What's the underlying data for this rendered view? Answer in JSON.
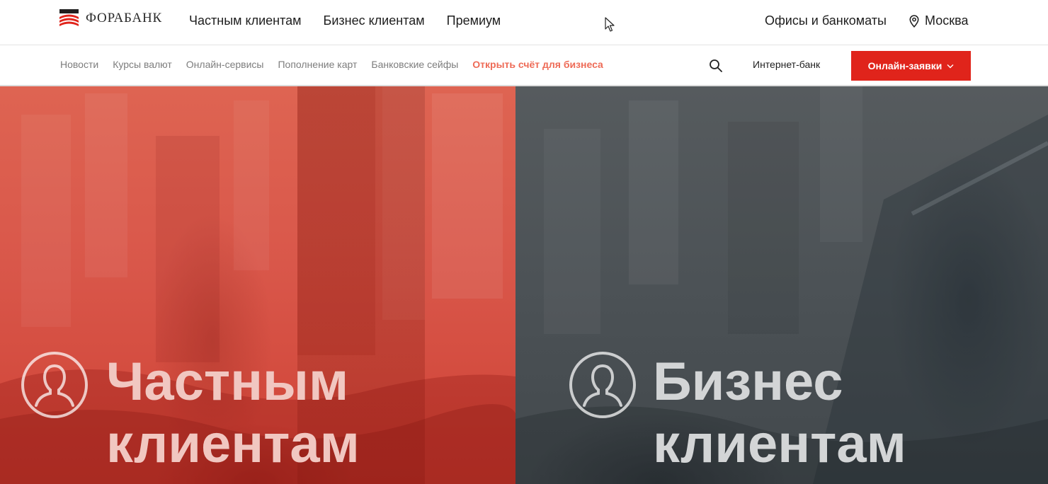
{
  "header": {
    "logo_text": "ФОРАБАНК",
    "main_nav": [
      {
        "label": "Частным клиентам"
      },
      {
        "label": "Бизнес клиентам"
      },
      {
        "label": "Премиум"
      }
    ],
    "offices_label": "Офисы и банкоматы",
    "city_label": "Москва"
  },
  "subheader": {
    "nav": [
      {
        "label": "Новости"
      },
      {
        "label": "Курсы валют"
      },
      {
        "label": "Онлайн-сервисы"
      },
      {
        "label": "Пополнение карт"
      },
      {
        "label": "Банковские сейфы"
      },
      {
        "label": "Открыть счёт для бизнеса"
      }
    ],
    "internet_bank_label": "Интернет-банк",
    "apply_label": "Онлайн-заявки"
  },
  "panels": {
    "private": {
      "line1": "Частным",
      "line2": "клиентам"
    },
    "business": {
      "line1": "Бизнес",
      "line2": "клиентам"
    }
  },
  "icons": {
    "logo": "bank-logo-icon",
    "city": "map-pin-icon",
    "search": "search-icon",
    "apply": "chevron-down-icon",
    "panel": "user-silhouette-icon",
    "cursor": "mouse-cursor-icon"
  },
  "colors": {
    "accent_red": "#e0241b",
    "accent_link": "#ee6b57",
    "private_panel": "#d9574a",
    "business_panel": "#4c5256"
  }
}
